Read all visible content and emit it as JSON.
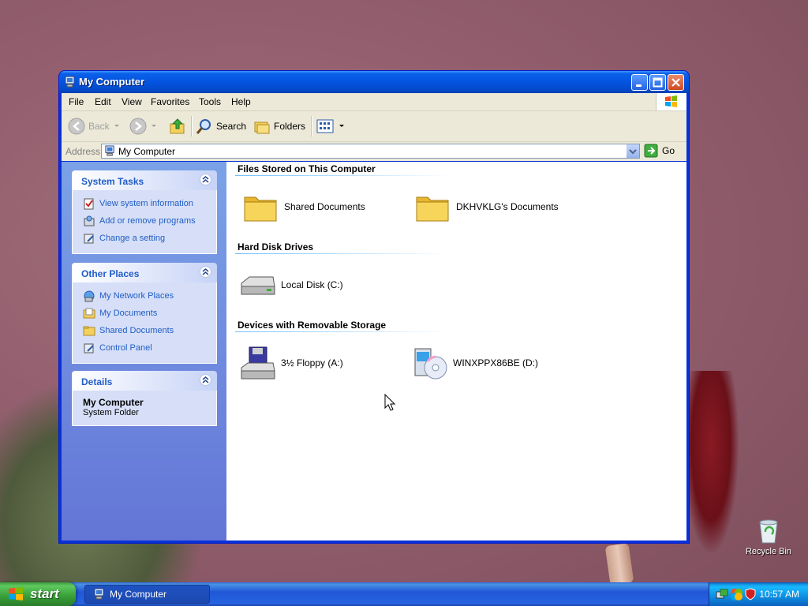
{
  "window": {
    "title": "My Computer",
    "menu": [
      "File",
      "Edit",
      "View",
      "Favorites",
      "Tools",
      "Help"
    ],
    "toolbar": {
      "back": "Back",
      "search": "Search",
      "folders": "Folders"
    },
    "address": {
      "label": "Address",
      "value": "My Computer",
      "go": "Go"
    }
  },
  "taskpane": {
    "system_tasks": {
      "title": "System Tasks",
      "items": [
        "View system information",
        "Add or remove programs",
        "Change a setting"
      ]
    },
    "other_places": {
      "title": "Other Places",
      "items": [
        "My Network Places",
        "My Documents",
        "Shared Documents",
        "Control Panel"
      ]
    },
    "details": {
      "title": "Details",
      "name": "My Computer",
      "type": "System Folder"
    }
  },
  "content": {
    "groups": [
      {
        "title": "Files Stored on This Computer",
        "items": [
          "Shared Documents",
          "DKHVKLG's Documents"
        ]
      },
      {
        "title": "Hard Disk Drives",
        "items": [
          "Local Disk (C:)"
        ]
      },
      {
        "title": "Devices with Removable Storage",
        "items": [
          "3½ Floppy (A:)",
          "WINXPPX86BE (D:)"
        ]
      }
    ]
  },
  "desktop": {
    "recycle_bin": "Recycle Bin"
  },
  "taskbar": {
    "start": "start",
    "task_button": "My Computer",
    "clock": "10:57 AM"
  },
  "icons": {
    "title": "computer-icon",
    "folder": "folder-icon",
    "disk": "hard-disk-icon",
    "floppy": "floppy-drive-icon",
    "cd": "cd-drive-icon"
  },
  "colors": {
    "title_bar": "#0454e0",
    "taskpane": "#6375d6",
    "link": "#215dc6",
    "start_button": "#379d37"
  }
}
